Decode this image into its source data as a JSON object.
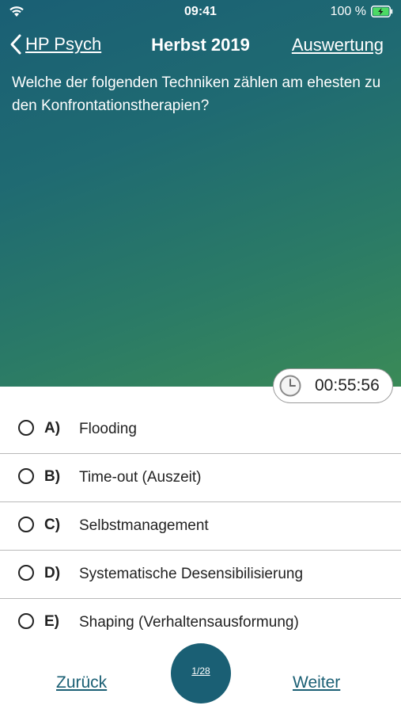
{
  "status": {
    "time": "09:41",
    "battery_percent": "100 %"
  },
  "nav": {
    "back_label": "HP Psych",
    "title": "Herbst 2019",
    "right_label": "Auswertung"
  },
  "question": {
    "text": "Welche der folgenden Techniken zählen am ehesten zu den Konfrontationstherapien?"
  },
  "timer": {
    "value": "00:55:56"
  },
  "options": [
    {
      "letter": "A)",
      "text": "Flooding"
    },
    {
      "letter": "B)",
      "text": "Time-out (Auszeit)"
    },
    {
      "letter": "C)",
      "text": "Selbstmanagement"
    },
    {
      "letter": "D)",
      "text": "Systematische Desensibilisierung"
    },
    {
      "letter": "E)",
      "text": "Shaping (Verhaltensausformung)"
    }
  ],
  "footer": {
    "prev_label": "Zurück",
    "page_indicator": "1/28",
    "next_label": "Weiter"
  },
  "colors": {
    "accent": "#1a5f74",
    "gradient_start": "#1a5f74",
    "gradient_end": "#3a8a57"
  },
  "icons": {
    "wifi": "wifi-icon",
    "battery": "battery-charging-icon",
    "back": "chevron-left-icon",
    "timer": "clock-icon",
    "radio": "radio-button-icon"
  }
}
